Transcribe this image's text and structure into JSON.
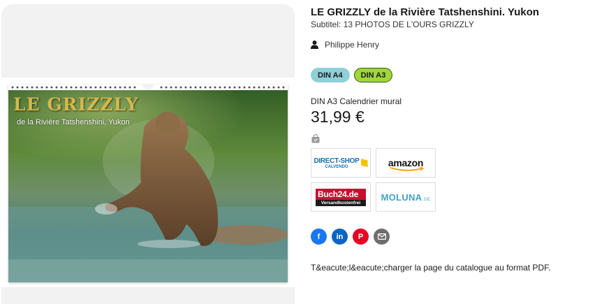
{
  "product": {
    "title": "LE GRIZZLY de la Rivière Tatshenshini. Yukon",
    "subtitle": "Subtitel: 13 PHOTOS DE L'OURS GRIZZLY",
    "author": "Philippe Henry"
  },
  "formats": [
    {
      "label": "DIN A4",
      "selected": false
    },
    {
      "label": "DIN A3",
      "selected": true
    }
  ],
  "purchase": {
    "product_line": "DIN A3 Calendrier mural",
    "price": "31,99 €"
  },
  "shops": [
    {
      "name": "DIRECT-SHOP",
      "sub": "CALVENDO"
    },
    {
      "name": "amazon"
    },
    {
      "name": "Buch24",
      "tld": ".de",
      "sub": "Versandkostenfrei"
    },
    {
      "name": "MOLUNA",
      "tld": ".DE"
    }
  ],
  "social": {
    "facebook": "f",
    "linkedin": "in",
    "pinterest": "P"
  },
  "pdf_link": "T&eacute;l&eacute;charger la page du catalogue au format PDF.",
  "calendar_cover": {
    "title": "LE GRIZZLY",
    "subtitle": "de la Rivière Tatshenshini, Yukon"
  },
  "colors": {
    "format_a4": "#8fd0d8",
    "format_a3": "#9fd63a",
    "facebook": "#1877f2",
    "linkedin": "#0a66c2",
    "pinterest": "#e60023",
    "mail": "#6e6e6e"
  },
  "icons": [
    "person-icon",
    "shopping-bag-icon",
    "facebook-icon",
    "linkedin-icon",
    "pinterest-icon",
    "mail-icon"
  ]
}
